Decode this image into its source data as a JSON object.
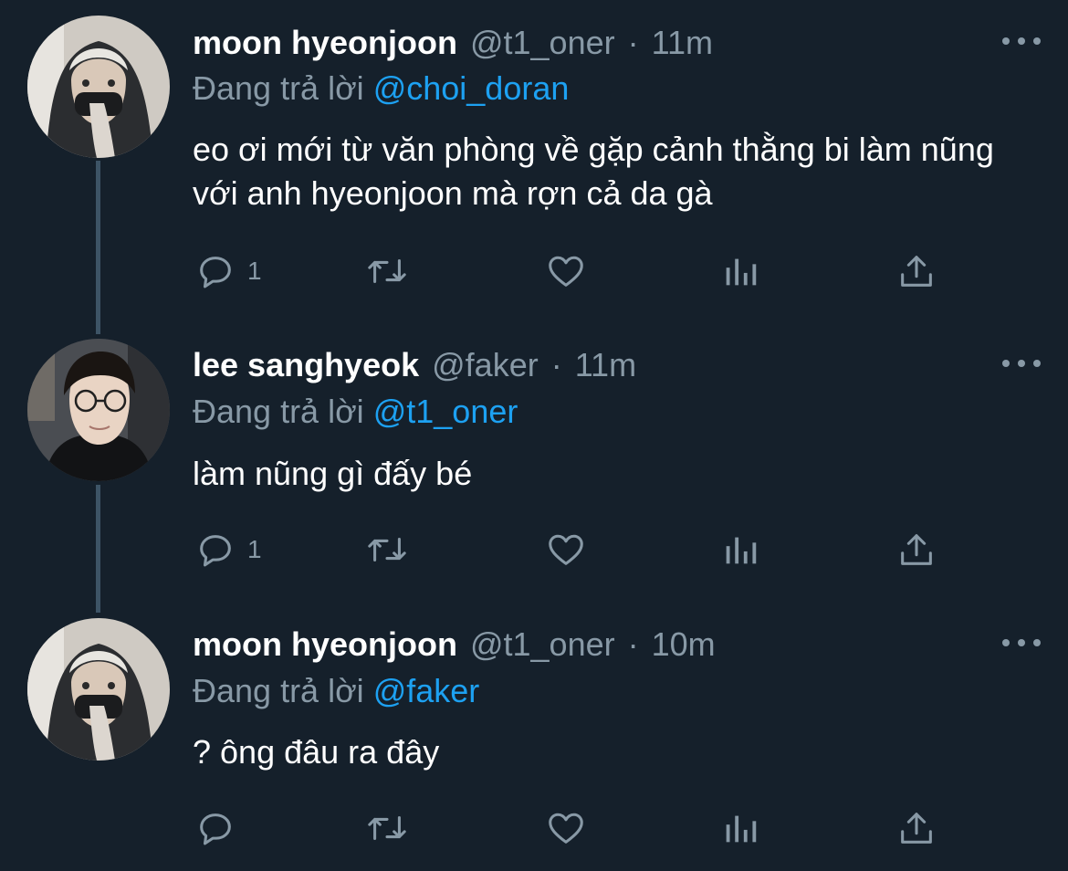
{
  "tweets": [
    {
      "display_name": "moon hyeonjoon",
      "handle": "@t1_oner",
      "separator": "·",
      "time": "11m",
      "reply_prefix": "Đang trả lời",
      "reply_to": "@choi_doran",
      "text": "eo ơi mới từ văn phòng về gặp cảnh thằng bi làm nũng với anh hyeonjoon mà rợn cả da gà",
      "reply_count": "1",
      "avatar_icon": "user-avatar-hooded-mask"
    },
    {
      "display_name": "lee sanghyeok",
      "handle": "@faker",
      "separator": "·",
      "time": "11m",
      "reply_prefix": "Đang trả lời",
      "reply_to": "@t1_oner",
      "text": "làm nũng gì đấy bé",
      "reply_count": "1",
      "avatar_icon": "user-avatar-glasses"
    },
    {
      "display_name": "moon hyeonjoon",
      "handle": "@t1_oner",
      "separator": "·",
      "time": "10m",
      "reply_prefix": "Đang trả lời",
      "reply_to": "@faker",
      "text": "? ông đâu ra đây",
      "reply_count": "",
      "avatar_icon": "user-avatar-hooded-mask"
    }
  ],
  "icons": {
    "reply": "speech-bubble-icon",
    "retweet": "retweet-icon",
    "like": "heart-icon",
    "views": "bar-chart-icon",
    "share": "share-upload-icon",
    "more": "more-dots-icon"
  },
  "colors": {
    "background": "#15202b",
    "secondary_text": "#8899a6",
    "link": "#1da1f2",
    "thread_line": "#3d5466"
  }
}
